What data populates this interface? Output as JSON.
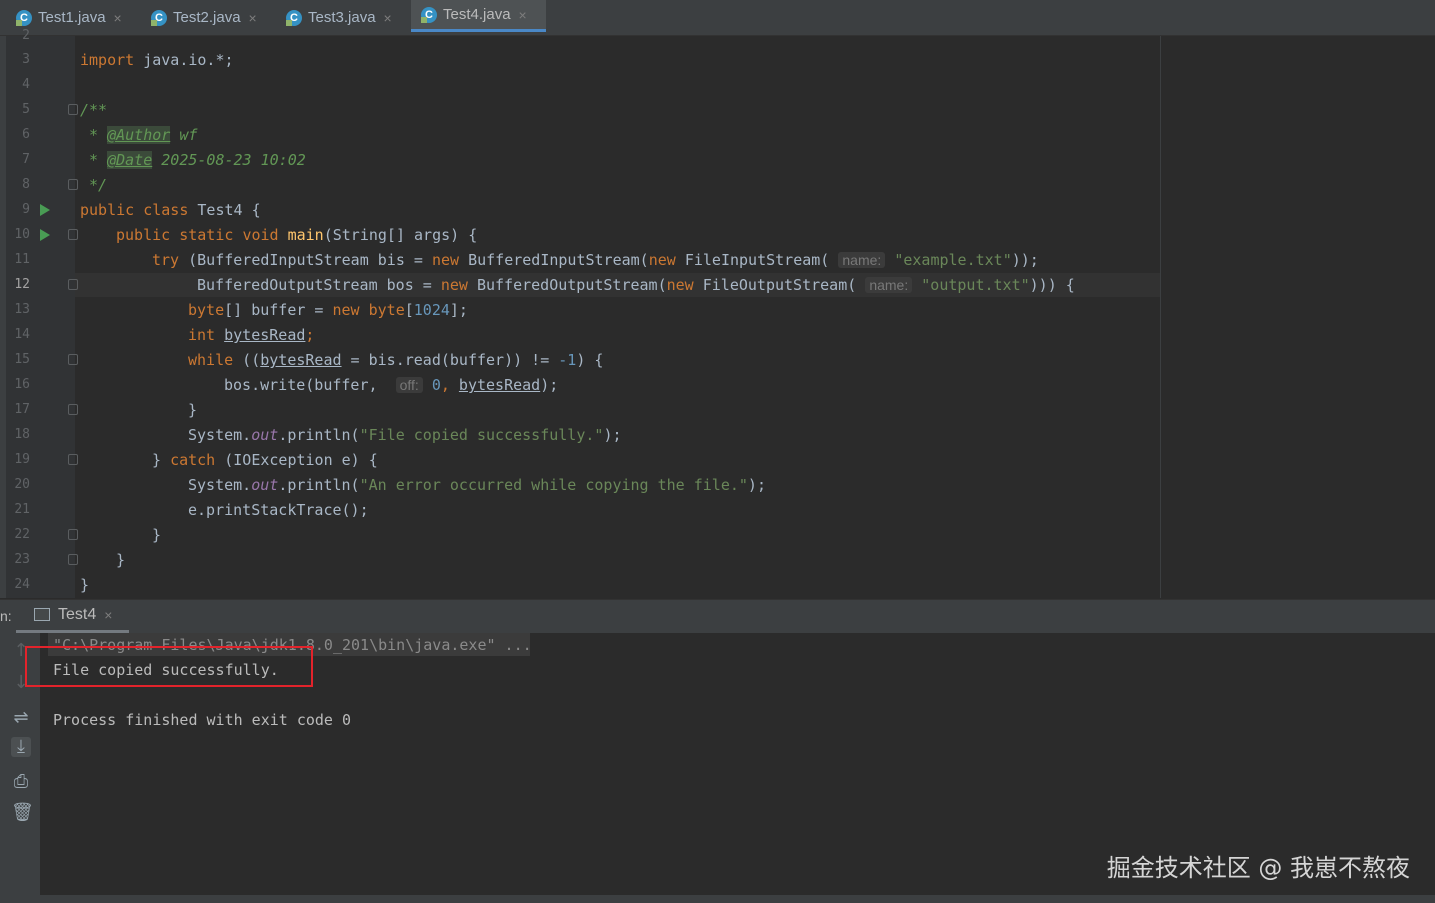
{
  "tabs": [
    {
      "label": "Test1.java",
      "icon": "java-class-icon",
      "active": false
    },
    {
      "label": "Test2.java",
      "icon": "java-class-icon",
      "active": false
    },
    {
      "label": "Test3.java",
      "icon": "java-class-icon",
      "active": false
    },
    {
      "label": "Test4.java",
      "icon": "java-class-icon",
      "active": true
    }
  ],
  "tab_close": "×",
  "editor": {
    "line_numbers": [
      "2",
      "3",
      "4",
      "5",
      "6",
      "7",
      "8",
      "9",
      "10",
      "11",
      "12",
      "13",
      "14",
      "15",
      "16",
      "17",
      "18",
      "19",
      "20",
      "21",
      "22",
      "23",
      "24"
    ],
    "current_line": "12",
    "tokens": {
      "import": "import",
      "import_path": " java.io.*;",
      "doc_open": "/**",
      "star": " * ",
      "author_tag": "@Author",
      "author_val": " wf",
      "date_tag": "@Date",
      "date_val": " 2025-08-23 10:02",
      "doc_close": " */",
      "public": "public",
      "class": "class",
      "class_name": " Test4 {",
      "static": "static",
      "void": "void",
      "main": "main",
      "main_args": "(String[] args) {",
      "try": "try",
      "try_open": " (BufferedInputStream bis = ",
      "new": "new",
      "bis_ctor": " BufferedInputStream(",
      "fis_ctor": " FileInputStream(",
      "hint_name": "name:",
      "example_file": "\"example.txt\"",
      "close_paren2": "));",
      "bos_decl": "BufferedOutputStream bos = ",
      "bos_ctor": " BufferedOutputStream(",
      "fos_ctor": " FileOutputStream(",
      "output_file": "\"output.txt\"",
      "close_paren3": "))) {",
      "byte_kw": "byte",
      "buffer_decl": "[] buffer = ",
      "byte_alloc": " byte",
      "size": "[1024];",
      "int": "int",
      "bytes_read": "bytesRead",
      "semi": ";",
      "while": "while",
      "while_open": " ((",
      "read_call": " = bis.read(buffer)) != ",
      "minus_one": "-1",
      ") {": ") {",
      "bos_write": "bos.write(buffer, ",
      "hint_off": "off:",
      "zero": "0",
      ", ": ", ",
      ");": ");",
      "close_brace": "}",
      "sysout": "System.",
      "out": "out",
      "println": ".println(",
      "msg_success": "\"File copied successfully.\"",
      "catch_open": "} ",
      "catch": "catch",
      "catch_args": " (IOException e) {",
      "msg_error": "\"An error occurred while copying the file.\"",
      "stack_trace": "e.printStackTrace();"
    }
  },
  "run_panel": {
    "label": "n:",
    "tab_label": "Test4",
    "command": "\"C:\\Program Files\\Java\\jdk1.8.0_201\\bin\\java.exe\" ...",
    "output": "File copied successfully.",
    "exit": "Process finished with exit code 0"
  },
  "watermark": "掘金技术社区 @ 我崽不熬夜",
  "colors": {
    "keyword": "#cc7832",
    "string": "#6a8759",
    "comment": "#629755",
    "number": "#6897bb",
    "method": "#ffc66d",
    "static_field": "#9876aa",
    "highlight_box": "#e3232b",
    "tab_accent": "#4a88c7"
  }
}
